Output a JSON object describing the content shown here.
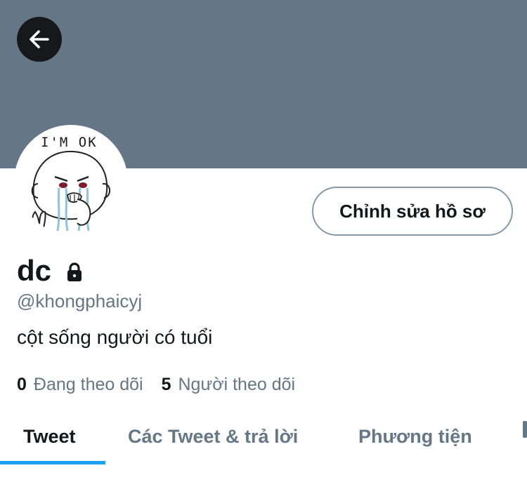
{
  "header": {
    "back_icon": "arrow-left-icon",
    "banner_color": "#657786"
  },
  "avatar": {
    "caption": "I'M OK"
  },
  "profile": {
    "edit_label": "Chỉnh sửa hồ sơ",
    "name": "dc",
    "lock_icon": "lock-icon",
    "handle": "@khongphaicyj",
    "bio": "cột sống người có tuổi"
  },
  "stats": {
    "following_count": "0",
    "following_label": "Đang theo dõi",
    "followers_count": "5",
    "followers_label": "Người theo dõi"
  },
  "tabs": [
    {
      "label": "Tweet",
      "active": true
    },
    {
      "label": "Các Tweet & trả lời",
      "active": false
    },
    {
      "label": "Phương tiện",
      "active": false
    }
  ],
  "colors": {
    "accent": "#1da1f2",
    "secondary_text": "#657786",
    "primary_text": "#14171a"
  }
}
